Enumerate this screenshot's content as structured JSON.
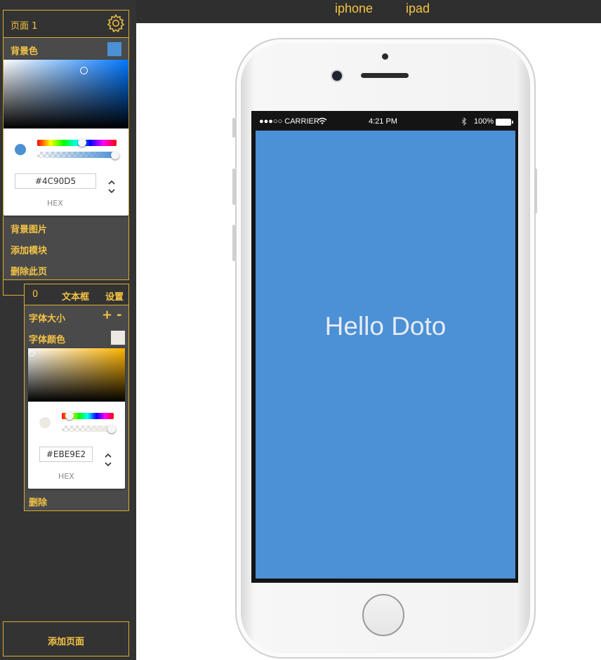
{
  "header": {
    "tabs": [
      {
        "label": "iphone"
      },
      {
        "label": "ipad"
      }
    ]
  },
  "page_panel": {
    "title": "页面 1",
    "bg_color_label": "背景色",
    "bg_color": "#4C90D5",
    "picker": {
      "hex_value": "#4C90D5",
      "mode_label": "HEX",
      "hue_color": "#0077ff"
    },
    "menu": [
      {
        "label": "背景图片"
      },
      {
        "label": "添加模块"
      },
      {
        "label": "删除此页"
      }
    ]
  },
  "element_panel": {
    "index": "0",
    "type_label": "文本框",
    "settings_label": "设置",
    "font_size_label": "字体大小",
    "increase_label": "+",
    "decrease_label": "-",
    "font_color_label": "字体颜色",
    "font_color": "#EBE9E2",
    "picker": {
      "hex_value": "#EBE9E2",
      "mode_label": "HEX",
      "hue_color": "#ffb400"
    },
    "delete_label": "删除"
  },
  "add_page_label": "添加页面",
  "phone": {
    "status": {
      "carrier": "●●●○○ CARRIER",
      "time": "4:21 PM",
      "battery": "100%"
    },
    "screen_text": "Hello Doto",
    "screen_bg": "#4C90D5"
  }
}
